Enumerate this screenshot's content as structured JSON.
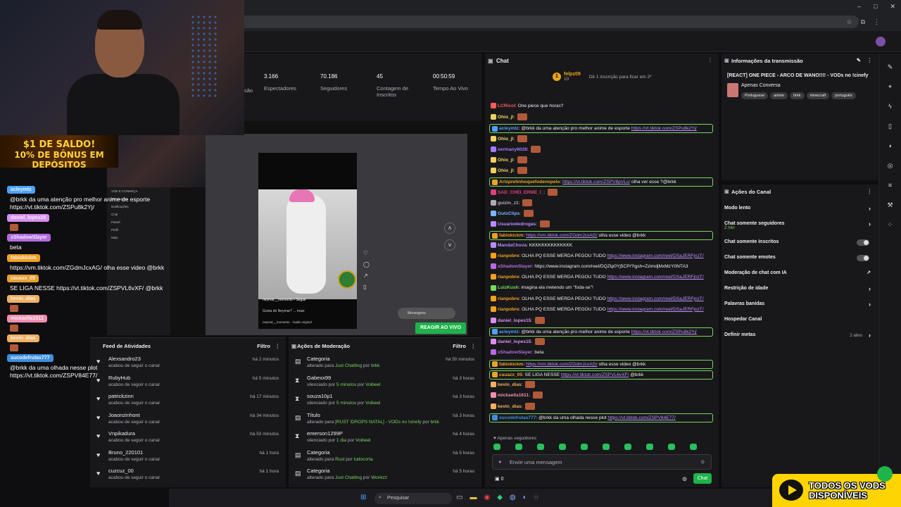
{
  "stats": [
    {
      "value": "3.166",
      "label": "Espectadores"
    },
    {
      "value": "70.186",
      "label": "Seguidores"
    },
    {
      "value": "45",
      "label": "Contagem de Inscritos"
    },
    {
      "value": "00:50:59",
      "label": "Tempo Ao Vivo"
    }
  ],
  "stat_cut_label": "são",
  "promo": {
    "line1": "$1 DE SALDO!",
    "line2": "10% DE BÔNUS EM DEPÓSITOS"
  },
  "overlay_chat": [
    {
      "user": "acleymtz",
      "color": "#4aa3ff",
      "msg": "@brkk da uma atenção pro melhor anime de esporte https://vt.tiktok.com/ZSPu8k2Yj/"
    },
    {
      "user": "daniel_lopes15",
      "color": "#d88ef0",
      "msg": ""
    },
    {
      "user": "xShadowSlayer",
      "color": "#b46be0",
      "msg": "beta"
    },
    {
      "user": "fabiokickm",
      "color": "#f0a020",
      "msg": "https://vm.tiktok.com/ZGdmJcxAG/ olha esse video @brkk"
    },
    {
      "user": "cauazx_05",
      "color": "#e8a030",
      "msg": "SE LIGA NESSE https://vt.tiktok.com/ZSPVL6vXF/ @brkk"
    },
    {
      "user": "kevin_dias",
      "color": "#f0b060",
      "msg": ""
    },
    {
      "user": "mickaella1611",
      "color": "#f28db3",
      "msg": ""
    },
    {
      "user": "kevin_dias",
      "color": "#f0b060",
      "msg": ""
    },
    {
      "user": "sucodefrutas777",
      "color": "#3d8fe0",
      "msg": "@brkk da uma olhada nesse plot https://vt.tiktok.com/ZSPV84E77/"
    }
  ],
  "video": {
    "user": "neymar__moments • Seguir",
    "question": "Gosta do Neymar? ... mais",
    "audio": "neymar__moments · Áudio original",
    "react_button": "REAGIR AO VIVO",
    "messages_pill": "Mensagens",
    "sidebar": [
      "VOE E CONHEÇA",
      "Mensagens",
      "Notificações",
      "Criar",
      "Painel",
      "Perfil",
      "Mais"
    ]
  },
  "feed": {
    "title": "Feed de Atividades",
    "filter": "Filtro",
    "rows": [
      {
        "name": "Alexsandro23",
        "sub": "acabou de seguir o canal",
        "time": "há 2 minutos"
      },
      {
        "name": "RubyHub",
        "sub": "acabou de seguir o canal",
        "time": "há 5 minutos"
      },
      {
        "name": "patrickzinn",
        "sub": "acabou de seguir o canal",
        "time": "há 17 minutos"
      },
      {
        "name": "Joaonzinhont",
        "sub": "acabou de seguir o canal",
        "time": "há 34 minutos"
      },
      {
        "name": "Vnpikadura",
        "sub": "acabou de seguir o canal",
        "time": "há 53 minutos"
      },
      {
        "name": "Bruno_220101",
        "sub": "acabou de seguir o canal",
        "time": "há 1 hora"
      },
      {
        "name": "cuzcuz_00",
        "sub": "acabou de seguir o canal",
        "time": "há 1 hora"
      }
    ]
  },
  "mod": {
    "title": "Ações de Moderação",
    "filter": "Filtro",
    "rows": [
      {
        "icon": "▤",
        "name": "Categoria",
        "pre": "alterado para ",
        "val": "Just Chatting",
        "mid": " por ",
        "by": "brkk",
        "time": "há 50 minutos"
      },
      {
        "icon": "⧗",
        "name": "Gabexx99",
        "pre": "silenciado por ",
        "val": "5 minutos",
        "mid": " por ",
        "by": "Voibeel",
        "time": "há 3 horas"
      },
      {
        "icon": "⧗",
        "name": "souza10p1",
        "pre": "silenciado por ",
        "val": "5 minutos",
        "mid": " por ",
        "by": "Voibeel",
        "time": "há 3 horas"
      },
      {
        "icon": "▤",
        "name": "Título",
        "pre": "alterado para ",
        "val": "[RUST !DROPS NATAL] - VODs no !cinefy",
        "mid": " por ",
        "by": "brkk",
        "time": "há 3 horas"
      },
      {
        "icon": "⧗",
        "name": "emerson1299P",
        "pre": "silenciado por ",
        "val": "1 dia",
        "mid": " por ",
        "by": "Voibeel",
        "time": "há 4 horas"
      },
      {
        "icon": "▤",
        "name": "Categoria",
        "pre": "alterado para ",
        "val": "Rust",
        "mid": " por ",
        "by": "tudocorta",
        "time": "há 5 horas"
      },
      {
        "icon": "▤",
        "name": "Categoria",
        "pre": "alterado para ",
        "val": "Just Chatting",
        "mid": " por ",
        "by": "Wonkzz",
        "time": "há 5 horas"
      }
    ]
  },
  "chat": {
    "title": "Chat",
    "goal_user": "felpz09",
    "goal_count": "10",
    "goal_text": "Dê 1 inscrição para ficar em 2º",
    "lines": [
      {
        "u": "LCRicol",
        "c": "#ff5a5a",
        "t": "One piece que horas?",
        "hl": false
      },
      {
        "u": "Ohio_jl",
        "c": "#f0d060",
        "t": "",
        "emote": true,
        "hl": false
      },
      {
        "u": "acleymtz",
        "c": "#4aa3ff",
        "t": "@brkk da uma atenção pro melhor anime de esporte ",
        "link": "https://vt.tiktok.com/ZSPu8k2Yj/",
        "hl": true
      },
      {
        "u": "Ohio_jl",
        "c": "#f0d060",
        "t": "",
        "emote": true,
        "hl": false
      },
      {
        "u": "sermany6028",
        "c": "#9f7bff",
        "t": "",
        "emote": true,
        "hl": false
      },
      {
        "u": "Ohio_jl",
        "c": "#f0d060",
        "t": "",
        "emote": true,
        "hl": false
      },
      {
        "u": "Ohio_jl",
        "c": "#f0d060",
        "t": "",
        "emote": true,
        "hl": false
      },
      {
        "u": "Artzpretinhoquefodenopelo",
        "c": "#e6a719",
        "t": " olha ver esse ?@brkk",
        "link": "https://vt.tiktok.com/ZSPV8pVLc/",
        "linkfirst": true,
        "hl": true
      },
      {
        "u": "SAD_CHEI_ERME_I_",
        "c": "#e0407a",
        "t": "",
        "emote": true,
        "hl": false
      },
      {
        "u": "guizin_z1",
        "c": "#adadb8",
        "t": "",
        "emote": true,
        "hl": false
      },
      {
        "u": "GutsClips",
        "c": "#7ab6ff",
        "t": "",
        "emote": true,
        "hl": false
      },
      {
        "u": "Usuariodedrogas",
        "c": "#b48cff",
        "t": "",
        "emote": true,
        "hl": false
      },
      {
        "u": "fabiokickm",
        "c": "#f0a020",
        "t": " olha esse video @brkk",
        "link": "https://vm.tiktok.com/ZGdmJcxAG/",
        "linkfirst": true,
        "hl": true
      },
      {
        "u": "MandaChuva",
        "c": "#b48cff",
        "t": "KKKKKKKKKKKKKK",
        "hl": false
      },
      {
        "u": "rianpobre",
        "c": "#f0a020",
        "t": "OLHA PQ ESSE MERDA PEGOU TUDO ",
        "link": "https://www.instagram.com/reel/DSaJERFjnzT/",
        "hl": false
      },
      {
        "u": "xShadowSlayer",
        "c": "#b46be0",
        "t": "https://www.instagram.com/reel/DQZtp0Yj5CP/?igsh=ZzimdjMxMzY0NTA3",
        "hl": false
      },
      {
        "u": "rianpobre",
        "c": "#f0a020",
        "t": "OLHA PQ ESSE MERDA PEGOU TUDO ",
        "link": "https://www.instagram.com/reel/DSaJERFjnzT/",
        "hl": false
      },
      {
        "u": "LuizKush",
        "c": "#7bd65f",
        "t": "imagina ela metendo um \"foda-se\"!",
        "hl": false
      },
      {
        "u": "rianpobre",
        "c": "#f0a020",
        "t": "OLHA PQ ESSE MERDA PEGOU TUDO ",
        "link": "https://www.instagram.com/reel/DSaJERFjnzT/",
        "hl": false
      },
      {
        "u": "rianpobre",
        "c": "#f0a020",
        "t": "OLHA PQ ESSE MERDA PEGOU TUDO ",
        "link": "https://www.instagram.com/reel/DSaJERFjnzT/",
        "hl": false
      },
      {
        "u": "daniel_lopes15",
        "c": "#d88ef0",
        "t": "",
        "emote": true,
        "hl": false
      },
      {
        "u": "acleymtz",
        "c": "#4aa3ff",
        "t": "@brkk da uma atenção pro melhor anime de esporte ",
        "link": "https://vt.tiktok.com/ZSPu8k2Yj/",
        "hl": true
      },
      {
        "u": "daniel_lopes15",
        "c": "#d88ef0",
        "t": "",
        "emote": true,
        "hl": false
      },
      {
        "u": "xShadowSlayer",
        "c": "#b46be0",
        "t": "beta",
        "hl": false
      },
      {
        "u": "fabiokickm",
        "c": "#f0a020",
        "t": " olha esse video @brkk",
        "link": "https://vm.tiktok.com/ZGdmJcxAG/",
        "linkfirst": true,
        "hl": true
      },
      {
        "u": "cauazx_05",
        "c": "#e8a030",
        "t": "SE LIGA NESSE ",
        "link": "https://vt.tiktok.com/ZSPVL6vXF/",
        "after": " @brkk",
        "hl": true
      },
      {
        "u": "kevin_dias",
        "c": "#f0b060",
        "t": "",
        "emote": true,
        "hl": false
      },
      {
        "u": "mickaella1611",
        "c": "#f28db3",
        "t": "",
        "emote": true,
        "hl": false
      },
      {
        "u": "kevin_dias",
        "c": "#f0b060",
        "t": "",
        "emote": true,
        "hl": false
      },
      {
        "u": "sucodefrutas777",
        "c": "#3d8fe0",
        "t": "@brkk da uma olhada nesse plot ",
        "link": "https://vt.tiktok.com/ZSPV84E77/",
        "hl": true
      }
    ],
    "followers_only": "Apenas seguidores",
    "placeholder": "Envie uma mensagem",
    "points": "0",
    "send": "Chat"
  },
  "info": {
    "title": "Informações da transmissão",
    "stream_title": "[REACT] ONE PIECE - ARCO DE WANO!!!! - VODs no !cinefy",
    "category": "Apenas Conversa",
    "tags": [
      "Portuguese",
      "anime",
      "brkk",
      "minecraft",
      "português"
    ]
  },
  "actions": {
    "title": "Ações do Canal",
    "items": [
      {
        "label": "Modo lento",
        "sub": "",
        "ctrl": "arrow"
      },
      {
        "label": "Chat somente seguidores",
        "sub": "2 min",
        "ctrl": "arrow"
      },
      {
        "label": "Chat somente inscritos",
        "sub": "",
        "ctrl": "toggle"
      },
      {
        "label": "Chat somente emotes",
        "sub": "",
        "ctrl": "toggle"
      },
      {
        "label": "Moderação de chat com IA",
        "sub": "",
        "ctrl": "ext"
      },
      {
        "label": "Restrição de idade",
        "sub": "",
        "ctrl": "arrow"
      },
      {
        "label": "Palavras banidas",
        "sub": "",
        "ctrl": "arrow"
      },
      {
        "label": "Hospedar Canal",
        "sub": "",
        "ctrl": ""
      },
      {
        "label": "Definir metas",
        "sub": "",
        "ctrl": "arrow",
        "status": "2 ativo"
      }
    ]
  },
  "taskbar": {
    "search": "Pesquisar"
  },
  "todos": {
    "line1": "TODOS OS VODS",
    "line2": "DISPONÍVEIS"
  }
}
